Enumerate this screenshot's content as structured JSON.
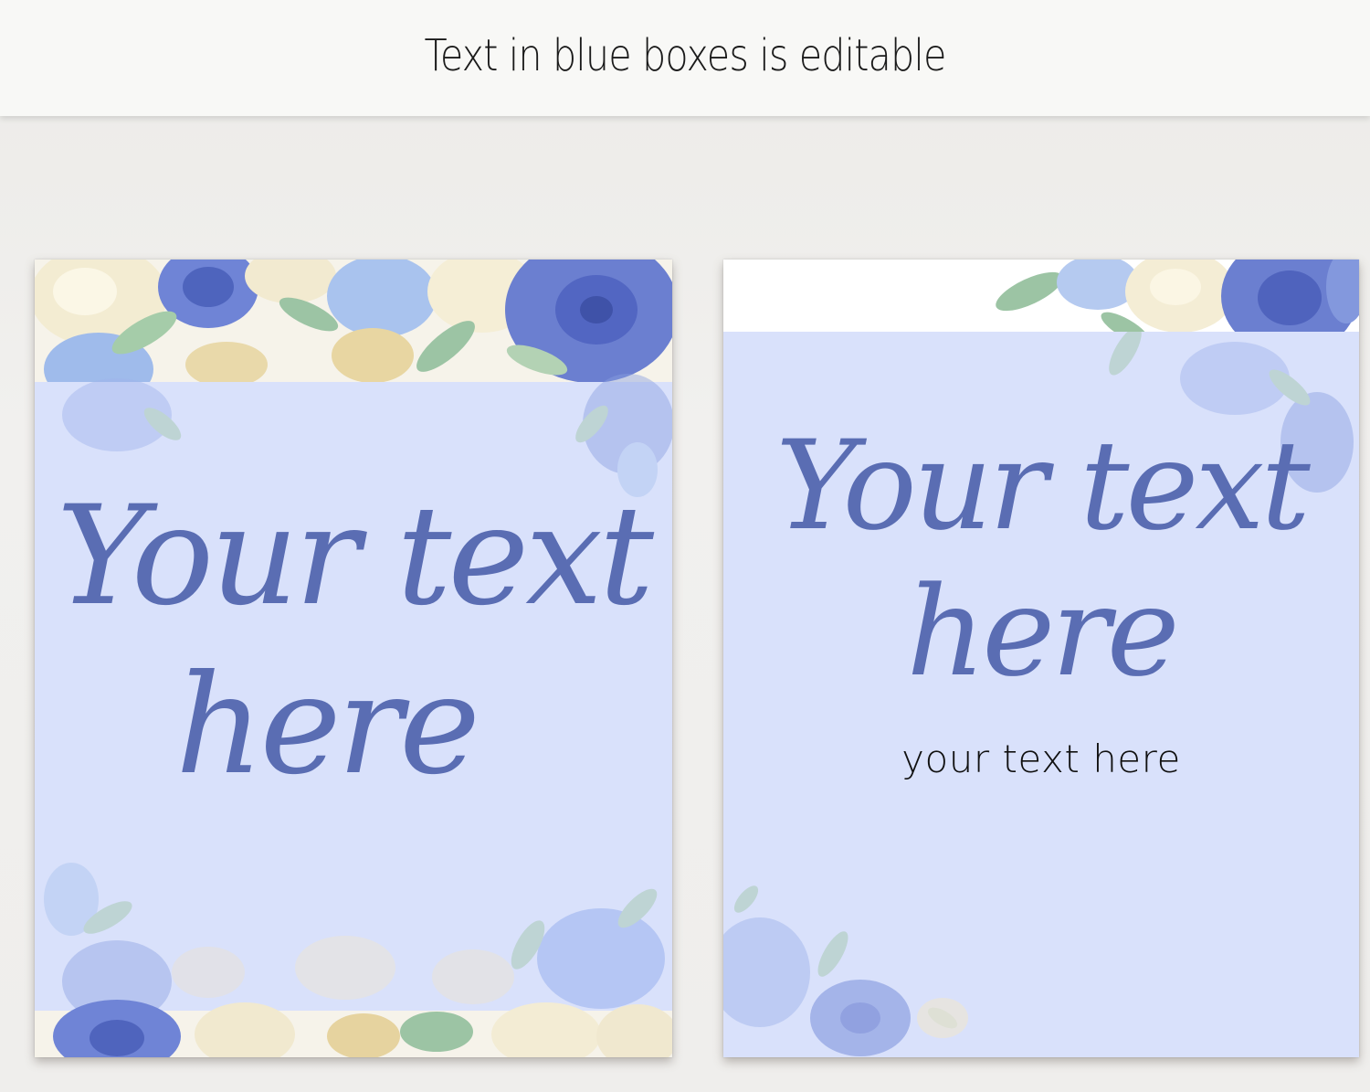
{
  "banner": {
    "text": "Text in blue boxes is editable"
  },
  "cards": {
    "left": {
      "line1": "Your text",
      "line2": "here"
    },
    "right": {
      "line1": "Your text",
      "line2": "here",
      "subtext": "your text here"
    }
  },
  "colors": {
    "editable_box": "#d9e1fb",
    "script_text": "#5a6db3",
    "rose_blue": "#6a7fd0",
    "rose_cream": "#f1ead0",
    "leaf": "#9cc4a4"
  }
}
